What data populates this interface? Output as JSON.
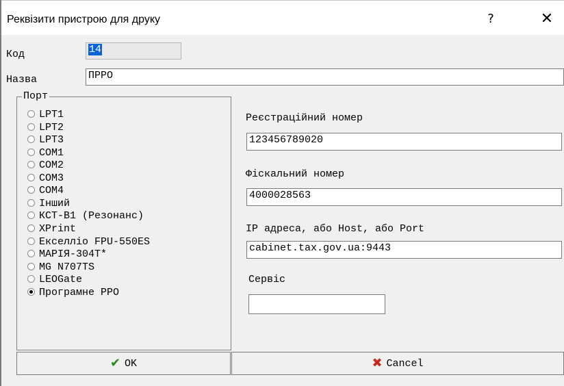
{
  "window": {
    "title": "Реквізити пристрою для друку",
    "help_glyph": "?",
    "close_glyph": "✕"
  },
  "form": {
    "code_label": "Код",
    "code_value": "14",
    "name_label": "Назва",
    "name_value": "ПРРО",
    "port_group_label": "Порт",
    "ports": [
      {
        "label": "LPT1",
        "selected": false
      },
      {
        "label": "LPT2",
        "selected": false
      },
      {
        "label": "LPT3",
        "selected": false
      },
      {
        "label": "COM1",
        "selected": false
      },
      {
        "label": "COM2",
        "selected": false
      },
      {
        "label": "COM3",
        "selected": false
      },
      {
        "label": "COM4",
        "selected": false
      },
      {
        "label": "Інший",
        "selected": false
      },
      {
        "label": "КСТ-В1 (Резонанс)",
        "selected": false
      },
      {
        "label": "XPrint",
        "selected": false
      },
      {
        "label": "Екселліо FPU-550ES",
        "selected": false
      },
      {
        "label": "МАРІЯ-304Т*",
        "selected": false
      },
      {
        "label": "MG N707TS",
        "selected": false
      },
      {
        "label": "LEOGate",
        "selected": false
      },
      {
        "label": "Програмне РРО",
        "selected": true
      }
    ],
    "reg_label": "Реєстраційний номер",
    "reg_value": "123456789020",
    "fiscal_label": "Фіскальний номер",
    "fiscal_value": "4000028563",
    "ip_label": "IP адреса, або Host, або Port",
    "ip_value": "cabinet.tax.gov.ua:9443",
    "service_label": "Сервіс",
    "service_value": ""
  },
  "buttons": {
    "ok_label": "OK",
    "ok_icon": "checkmark-icon",
    "cancel_label": "Cancel",
    "cancel_icon": "cross-icon"
  }
}
